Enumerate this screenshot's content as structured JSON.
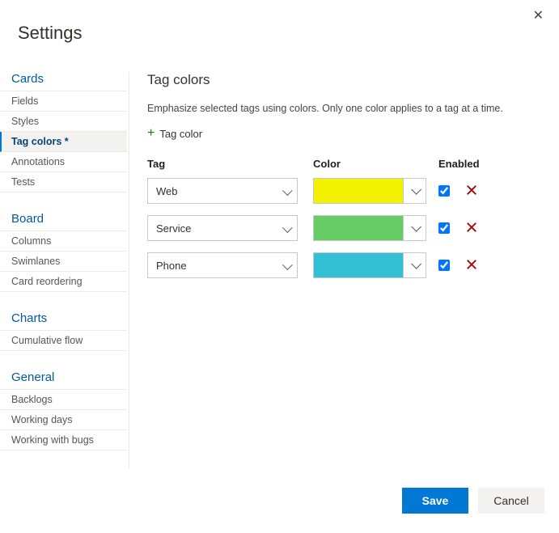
{
  "dialog": {
    "title": "Settings"
  },
  "sidebar": {
    "sections": [
      {
        "heading": "Cards",
        "items": [
          "Fields",
          "Styles",
          "Tag colors *",
          "Annotations",
          "Tests"
        ],
        "activeIndex": 2
      },
      {
        "heading": "Board",
        "items": [
          "Columns",
          "Swimlanes",
          "Card reordering"
        ],
        "activeIndex": -1
      },
      {
        "heading": "Charts",
        "items": [
          "Cumulative flow"
        ],
        "activeIndex": -1
      },
      {
        "heading": "General",
        "items": [
          "Backlogs",
          "Working days",
          "Working with bugs"
        ],
        "activeIndex": -1
      }
    ]
  },
  "main": {
    "heading": "Tag colors",
    "description": "Emphasize selected tags using colors. Only one color applies to a tag at a time.",
    "addButton": "Tag color",
    "columns": {
      "tag": "Tag",
      "color": "Color",
      "enabled": "Enabled"
    },
    "rows": [
      {
        "tag": "Web",
        "color": "#f2f200",
        "enabled": true
      },
      {
        "tag": "Service",
        "color": "#66cc66",
        "enabled": true
      },
      {
        "tag": "Phone",
        "color": "#33bfd6",
        "enabled": true
      }
    ]
  },
  "footer": {
    "save": "Save",
    "cancel": "Cancel"
  }
}
